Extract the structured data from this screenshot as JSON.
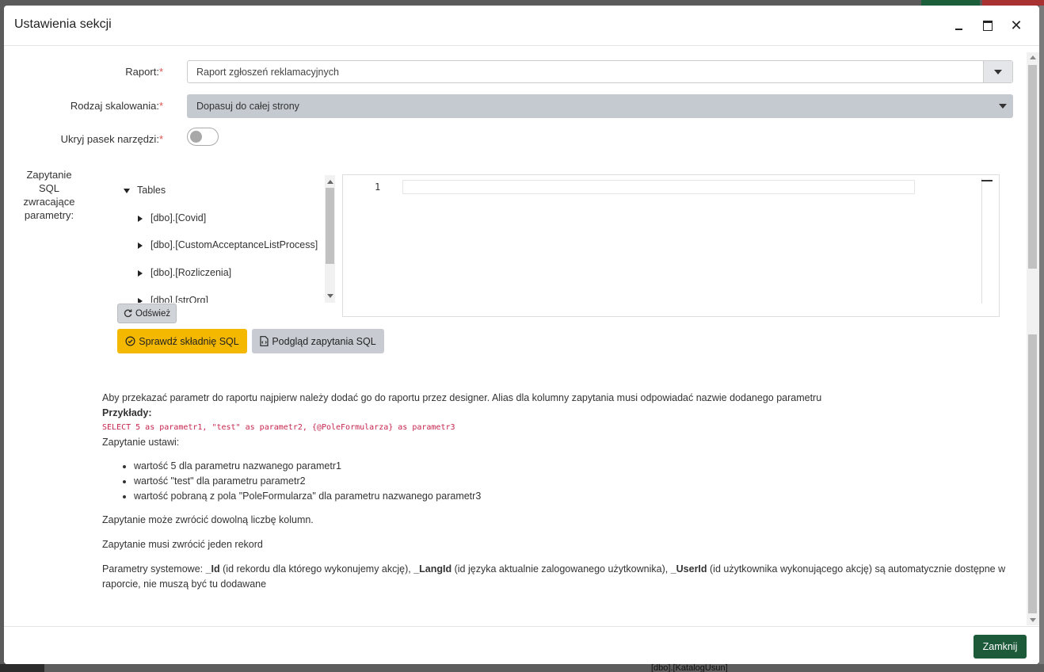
{
  "dialog": {
    "title": "Ustawienia sekcji",
    "close_glyph": "✕"
  },
  "form": {
    "report_label": "Raport:",
    "report_value": "Raport zgłoszeń reklamacyjnych",
    "scaling_label": "Rodzaj skalowania:",
    "scaling_value": "Dopasuj do całej strony",
    "toolbar_label": "Ukryj pasek narzędzi:",
    "toolbar_hidden": false,
    "required_mark": "*",
    "sql_label_lines": [
      "Zapytanie",
      "SQL",
      "zwracające",
      "parametry:"
    ]
  },
  "tree": {
    "root": "Tables",
    "items": [
      "[dbo].[Covid]",
      "[dbo].[CustomAcceptanceListProcess]",
      "[dbo].[Rozliczenia]",
      "[dbo].[strOrg]"
    ]
  },
  "editor": {
    "line_number": "1",
    "content": ""
  },
  "buttons": {
    "refresh": "Odśwież",
    "check_sql": "Sprawdź składnię SQL",
    "preview_sql": "Podgląd zapytania SQL",
    "close": "Zamknij"
  },
  "help": {
    "intro": "Aby przekazać parametr do raportu najpierw należy dodać go do raportu przez designer. Alias dla kolumny zapytania musi odpowiadać nazwie dodanego parametru",
    "examples_heading": "Przykłady:",
    "example_code": "SELECT 5 as parametr1, \"test\" as parametr2, {@PoleFormularza} as parametr3",
    "sets_text": "Zapytanie ustawi:",
    "bullets": [
      "wartość 5 dla parametru nazwanego parametr1",
      "wartość \"test\" dla parametru parametr2",
      "wartość pobraną z pola \"PoleFormularza\" dla parametru nazwanego parametr3"
    ],
    "columns_text": "Zapytanie może zwrócić dowolną liczbę kolumn.",
    "record_text": "Zapytanie musi zwrócić jeden rekord",
    "system_params": {
      "prefix": "Parametry systemowe: ",
      "p1": "_Id",
      "p1_desc": " (id rekordu dla którego wykonujemy akcję), ",
      "p2": "_LangId",
      "p2_desc": " (id języka aktualnie zalogowanego użytkownika), ",
      "p3": "_UserId",
      "p3_desc": " (id użytkownika wykonującego akcję) są automatycznie dostępne w raporcie, nie muszą być tu dodawane"
    }
  },
  "background": {
    "bottom_text": "[dbo].[KatalogUsun]"
  },
  "colors": {
    "accent_yellow": "#f5b800",
    "close_green": "#1d5a3a",
    "required_red": "#d9534f",
    "code_pink": "#c7254e"
  }
}
